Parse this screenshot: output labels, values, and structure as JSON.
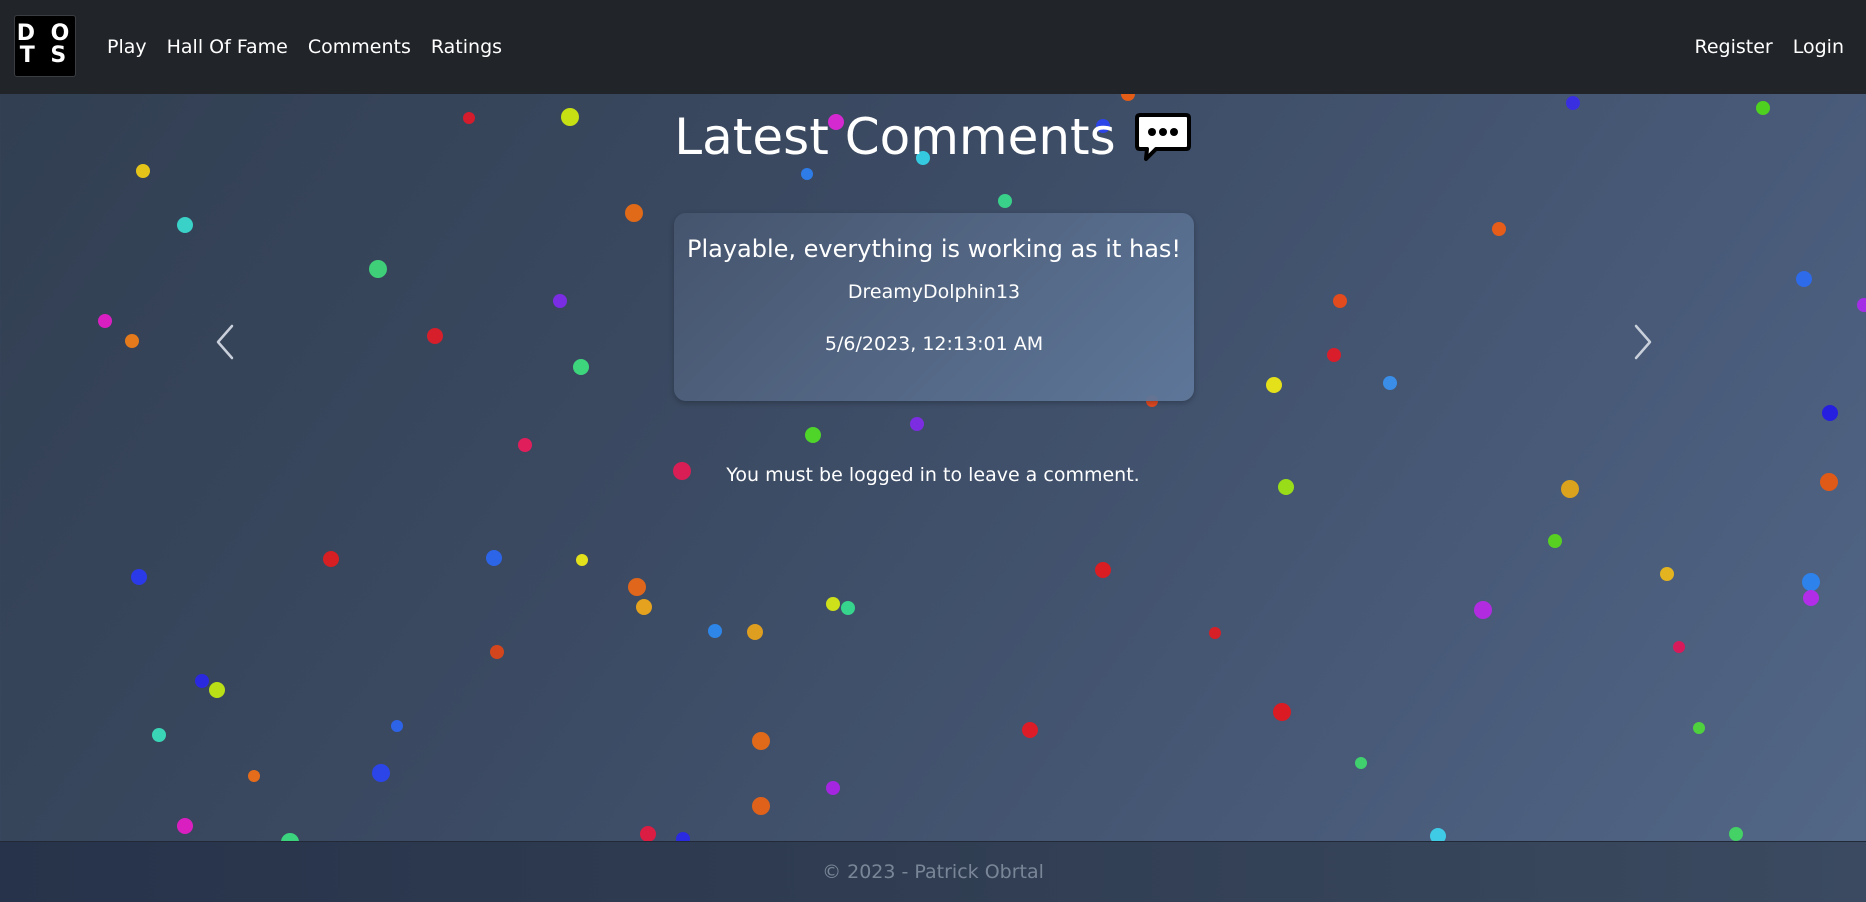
{
  "nav": {
    "logo_lines": [
      "D O",
      "T S"
    ],
    "left_links": [
      "Play",
      "Hall Of Fame",
      "Comments",
      "Ratings"
    ],
    "right_links": [
      "Register",
      "Login"
    ]
  },
  "page": {
    "title": "Latest Comments",
    "title_icon": "speech-bubble-ellipsis-icon"
  },
  "comment": {
    "text": "Playable, everything is working as it has!",
    "author": "DreamyDolphin13",
    "date": "5/6/2023, 12:13:01 AM"
  },
  "carousel": {
    "prev_icon": "chevron-left-icon",
    "next_icon": "chevron-right-icon"
  },
  "login_note": "You must be logged in to leave a comment.",
  "footer": {
    "text": "© 2023 - Patrick Obrtal"
  },
  "colors": {
    "navbar": "#212429",
    "background_start": "#313e51",
    "background_end": "#536787",
    "text": "#ffffff",
    "footer_text": "#7a8698"
  }
}
